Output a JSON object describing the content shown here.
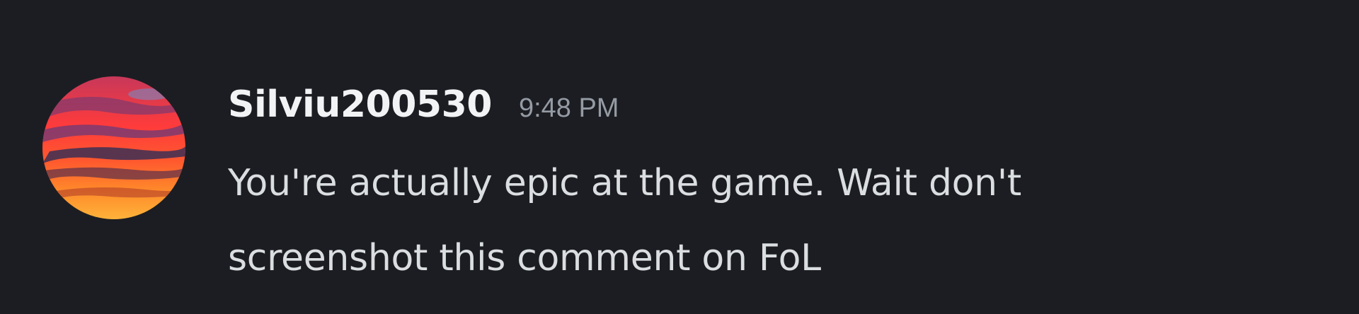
{
  "message": {
    "author": "Silviu200530",
    "timestamp": "9:48 PM",
    "text": "You're actually epic at the game. Wait don't screenshot this comment on FoL",
    "avatar": {
      "icon": "sunset-sky-avatar",
      "colors": [
        "#ff3b3b",
        "#ff7a2a",
        "#ffb23a",
        "#6a3a78",
        "#2b2a4a"
      ]
    }
  },
  "theme": {
    "background": "#1c1d22",
    "username_color": "#f2f3f5",
    "timestamp_color": "#949ba4",
    "text_color": "#dbdee1"
  }
}
